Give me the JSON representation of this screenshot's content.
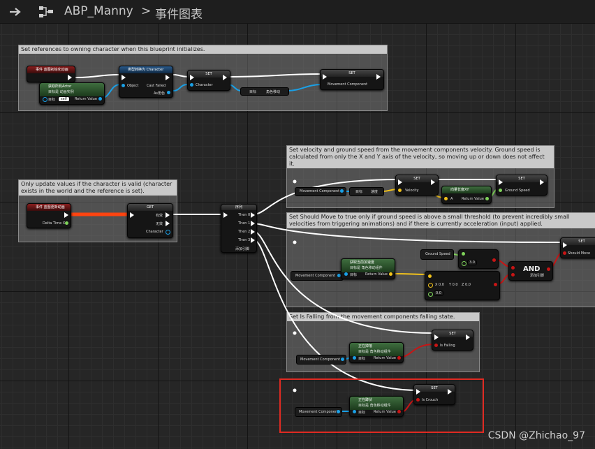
{
  "header": {
    "app_icon": "blueprint-graph-icon",
    "blueprint_name": "ABP_Manny",
    "separator": ">",
    "graph_name": "事件图表"
  },
  "comments": {
    "c1": "Set references to owning character when this blueprint initializes.",
    "c2": "Only update values if the character is valid (character exists in the world and the reference is set).",
    "c3": "Set velocity and ground speed from the movement components velocity. Ground speed is calculated from only the X and Y axis of the velocity, so moving up or down does not affect it.",
    "c4": "Set Should Move to true only if ground speed is above a small threshold (to prevent incredibly small velocities from triggering animations) and if there is currently acceleration (input) applied.",
    "c5": "Set Is Falling from the movement components falling state."
  },
  "nodes": {
    "init_event": "事件 蓝图初始化动画",
    "get_owning_title": "获取所有Actor",
    "get_owning_sub": "目标是 动画实例",
    "target": "目标",
    "self_val": "self",
    "return_value": "Return Value",
    "cast_title": "类型转换为 Character",
    "object": "Object",
    "cast_failed": "Cast Failed",
    "as_char": "As角色",
    "set": "SET",
    "character": "Character",
    "char_movement": "角色移动",
    "movement_component": "Movement Component",
    "update_event": "事件 蓝图更新动画",
    "delta_time": "Delta Time X",
    "get": "GET",
    "valid": "有效",
    "invalid": "无效",
    "sequence": "序列",
    "then0": "Then 0",
    "then1": "Then 1",
    "then2": "Then 2",
    "then3": "Then 3",
    "add_pin": "添加引脚",
    "velocity_getter": "速度",
    "velocity": "Velocity",
    "vector_length": "向量长度XY",
    "pin_a": "A",
    "ground_speed": "Ground Speed",
    "get_accel_title": "获取当前加速度",
    "get_accel_sub": "目标是 角色移动组件",
    "threshold": "3.0",
    "vec_x": "X 0.0",
    "vec_y": "Y 0.0",
    "vec_z": "Z 0.0",
    "zero": "0.0",
    "and_label": "AND",
    "should_move": "Should Move",
    "is_falling_fn": "正在掉落",
    "is_falling_sub": "目标是 角色移动组件",
    "is_falling": "Is Falling",
    "is_crouch_fn": "正在蹲伏",
    "is_crouch_sub": "目标是 角色移动组件",
    "is_crouch": "Is Crouch"
  },
  "watermark": "CSDN @Zhichao_97",
  "colors": {
    "exec": "#ffffff",
    "object_pin": "#1aa0e6",
    "float_pin": "#7fd35a",
    "vector_pin": "#f2c21b",
    "bool_pin": "#c81515",
    "highlight": "#e02a22"
  }
}
